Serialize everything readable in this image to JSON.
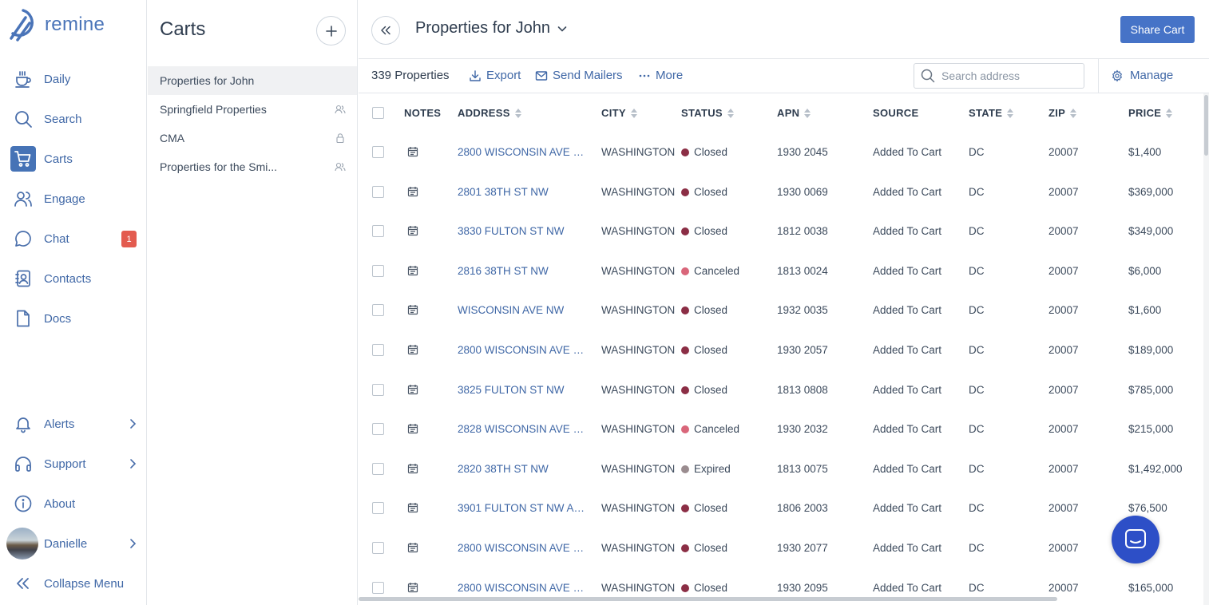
{
  "brand": {
    "name": "remine"
  },
  "nav": {
    "items": [
      {
        "label": "Daily",
        "icon": "coffee-icon"
      },
      {
        "label": "Search",
        "icon": "search-icon"
      },
      {
        "label": "Carts",
        "icon": "cart-icon",
        "active": true
      },
      {
        "label": "Engage",
        "icon": "people-icon"
      },
      {
        "label": "Chat",
        "icon": "chat-icon",
        "badge": "1"
      },
      {
        "label": "Contacts",
        "icon": "contacts-icon"
      },
      {
        "label": "Docs",
        "icon": "document-icon"
      }
    ],
    "bottom": [
      {
        "label": "Alerts",
        "icon": "bell-icon"
      },
      {
        "label": "Support",
        "icon": "headphones-icon"
      },
      {
        "label": "About",
        "icon": "info-icon"
      },
      {
        "label": "Danielle",
        "icon": "avatar"
      },
      {
        "label": "Collapse Menu",
        "icon": "double-chevron-left-icon"
      }
    ]
  },
  "carts": {
    "title": "Carts",
    "items": [
      {
        "label": "Properties for John",
        "active": true,
        "indicator": ""
      },
      {
        "label": "Springfield Properties",
        "indicator": "shared"
      },
      {
        "label": "CMA",
        "indicator": "locked"
      },
      {
        "label": "Properties for the Smi...",
        "indicator": "shared"
      }
    ]
  },
  "main": {
    "cart_title": "Properties for John",
    "share_label": "Share Cart",
    "count_label": "339 Properties",
    "export_label": "Export",
    "mailers_label": "Send Mailers",
    "more_label": "More",
    "search_placeholder": "Search address",
    "manage_label": "Manage"
  },
  "table": {
    "columns": [
      "NOTES",
      "ADDRESS",
      "CITY",
      "STATUS",
      "APN",
      "SOURCE",
      "STATE",
      "ZIP",
      "PRICE"
    ],
    "status_colors": {
      "Closed": "#8b2e45",
      "Canceled": "#d9667a",
      "Expired": "#9a8c8f"
    },
    "rows": [
      {
        "address": "2800 WISCONSIN AVE N...",
        "city": "WASHINGTON",
        "status": "Closed",
        "apn": "1930 2045",
        "source": "Added To Cart",
        "state": "DC",
        "zip": "20007",
        "price": "$1,400"
      },
      {
        "address": "2801 38TH ST NW",
        "city": "WASHINGTON",
        "status": "Closed",
        "apn": "1930 0069",
        "source": "Added To Cart",
        "state": "DC",
        "zip": "20007",
        "price": "$369,000"
      },
      {
        "address": "3830 FULTON ST NW",
        "city": "WASHINGTON",
        "status": "Closed",
        "apn": "1812 0038",
        "source": "Added To Cart",
        "state": "DC",
        "zip": "20007",
        "price": "$349,000"
      },
      {
        "address": "2816 38TH ST NW",
        "city": "WASHINGTON",
        "status": "Canceled",
        "apn": "1813 0024",
        "source": "Added To Cart",
        "state": "DC",
        "zip": "20007",
        "price": "$6,000"
      },
      {
        "address": "WISCONSIN AVE NW",
        "city": "WASHINGTON",
        "status": "Closed",
        "apn": "1932 0035",
        "source": "Added To Cart",
        "state": "DC",
        "zip": "20007",
        "price": "$1,600"
      },
      {
        "address": "2800 WISCONSIN AVE N...",
        "city": "WASHINGTON",
        "status": "Closed",
        "apn": "1930 2057",
        "source": "Added To Cart",
        "state": "DC",
        "zip": "20007",
        "price": "$189,000"
      },
      {
        "address": "3825 FULTON ST NW",
        "city": "WASHINGTON",
        "status": "Closed",
        "apn": "1813 0808",
        "source": "Added To Cart",
        "state": "DC",
        "zip": "20007",
        "price": "$785,000"
      },
      {
        "address": "2828 WISCONSIN AVE N...",
        "city": "WASHINGTON",
        "status": "Canceled",
        "apn": "1930 2032",
        "source": "Added To Cart",
        "state": "DC",
        "zip": "20007",
        "price": "$215,000"
      },
      {
        "address": "2820 38TH ST NW",
        "city": "WASHINGTON",
        "status": "Expired",
        "apn": "1813 0075",
        "source": "Added To Cart",
        "state": "DC",
        "zip": "20007",
        "price": "$1,492,000"
      },
      {
        "address": "3901 FULTON ST NW APT ...",
        "city": "WASHINGTON",
        "status": "Closed",
        "apn": "1806 2003",
        "source": "Added To Cart",
        "state": "DC",
        "zip": "20007",
        "price": "$76,500"
      },
      {
        "address": "2800 WISCONSIN AVE N...",
        "city": "WASHINGTON",
        "status": "Closed",
        "apn": "1930 2077",
        "source": "Added To Cart",
        "state": "DC",
        "zip": "20007",
        "price": "...00"
      },
      {
        "address": "2800 WISCONSIN AVE N...",
        "city": "WASHINGTON",
        "status": "Closed",
        "apn": "1930 2095",
        "source": "Added To Cart",
        "state": "DC",
        "zip": "20007",
        "price": "$165,000"
      }
    ]
  },
  "colors": {
    "accent": "#4673c7",
    "nav_text": "#3f67a6",
    "badge": "#e35b4f",
    "chat_fab": "#2d4fc7"
  }
}
